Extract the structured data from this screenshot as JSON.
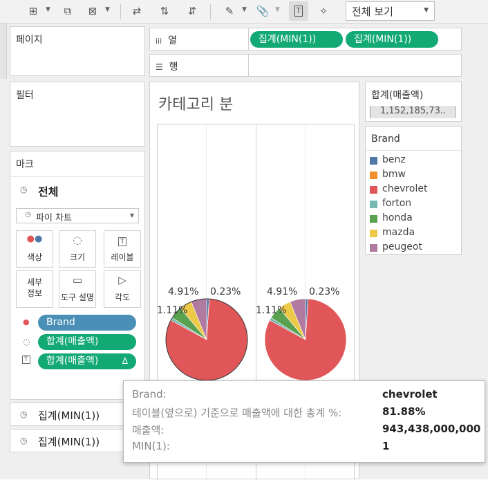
{
  "toolbar": {
    "view_select": "전체 보기"
  },
  "left": {
    "pages_title": "페이지",
    "filters_title": "필터",
    "marks_title": "마크",
    "marks_all": "전체",
    "mark_type": "파이 차트",
    "buttons": {
      "color": "색상",
      "size": "크기",
      "label": "레이블",
      "detail_1": "세부",
      "detail_2": "정보",
      "tooltip": "도구 설명",
      "angle": "각도"
    },
    "pills": {
      "brand": "Brand",
      "sales_1": "합계(매출액)",
      "sales_2": "합계(매출액)",
      "sales_2_delta": "Δ"
    },
    "min_cards": [
      "집계(MIN(1))",
      "집계(MIN(1))"
    ]
  },
  "shelves": {
    "columns_label": "열",
    "rows_label": "행",
    "column_pills": [
      "집계(MIN(1))",
      "집계(MIN(1))"
    ]
  },
  "view": {
    "title": "카테고리 분"
  },
  "right": {
    "sum_title": "합계(매출액)",
    "sum_value": "1,152,185,73..",
    "legend_title": "Brand",
    "legend": [
      {
        "name": "benz",
        "color": "#4e79a7"
      },
      {
        "name": "bmw",
        "color": "#f28e2b"
      },
      {
        "name": "chevrolet",
        "color": "#e15759"
      },
      {
        "name": "forton",
        "color": "#76b7b2"
      },
      {
        "name": "honda",
        "color": "#59a14f"
      },
      {
        "name": "mazda",
        "color": "#edc948"
      },
      {
        "name": "peugeot",
        "color": "#b07aa1"
      }
    ]
  },
  "chart_data": {
    "type": "pie",
    "title": "카테고리 분",
    "categories": [
      "benz",
      "bmw",
      "chevrolet",
      "forton",
      "honda",
      "mazda",
      "peugeot"
    ],
    "series": [
      {
        "values": [
          0.0099,
          0.0003,
          0.8188,
          0.0111,
          0.0491,
          0.0491,
          0.0617
        ]
      },
      {
        "values": [
          0.0099,
          0.0003,
          0.8188,
          0.0111,
          0.0491,
          0.0491,
          0.0617
        ]
      }
    ],
    "visible_labels": [
      "4.91%",
      "0.23%",
      "1.11%"
    ]
  },
  "tooltip": {
    "rows": [
      {
        "label": "Brand:",
        "value": "chevrolet"
      },
      {
        "label": "테이블(옆으로) 기준으로 매출액에 대한 총계 %:",
        "value": "81.88%"
      },
      {
        "label": "매출액:",
        "value": "943,438,000,000"
      },
      {
        "label": "MIN(1):",
        "value": "1"
      }
    ]
  }
}
